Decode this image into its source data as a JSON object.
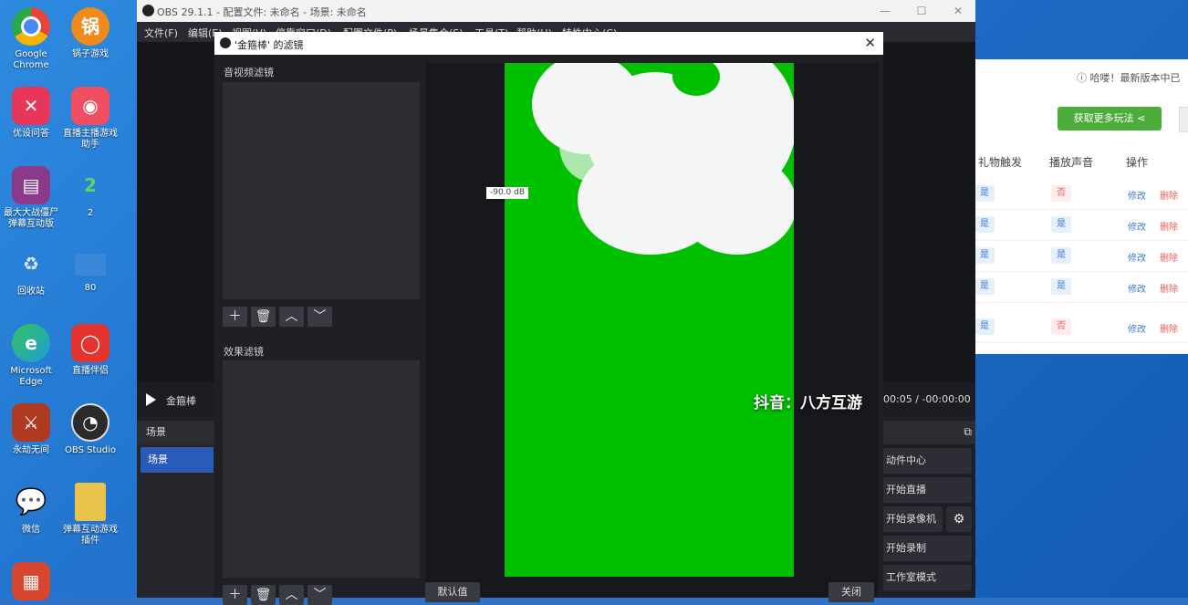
{
  "desktop": {
    "icons": [
      {
        "label": "Google Chrome",
        "icon": "chrome-icon",
        "color": "#e9443a"
      },
      {
        "label": "锅子游戏",
        "icon": "game-pot-icon",
        "color": "#f08a1c"
      },
      {
        "label": "优设问答",
        "icon": "video-edit-icon",
        "color": "#e8365b"
      },
      {
        "label": "直播主播游戏助手",
        "icon": "live-helper-icon",
        "color": "#f04e62"
      },
      {
        "label": "最大大战僵尸弹幕互动版",
        "icon": "winrar-icon",
        "color": "#8a3a88"
      },
      {
        "label": "2",
        "icon": "number-icon",
        "color": "#1e6bd0"
      },
      {
        "label": "回收站",
        "icon": "recycle-bin-icon",
        "color": "#4d8fd6"
      },
      {
        "label": "80",
        "icon": "blank-icon",
        "color": "#2a76d2"
      },
      {
        "label": "Microsoft Edge",
        "icon": "edge-icon",
        "color": "#1f9bd7"
      },
      {
        "label": "直播伴侣",
        "icon": "live-companion-icon",
        "color": "#e5332f"
      },
      {
        "label": "永劫无间",
        "icon": "naraka-icon",
        "color": "#b03a21"
      },
      {
        "label": "OBS Studio",
        "icon": "obs-icon",
        "color": "#2b2b2b"
      },
      {
        "label": "微信",
        "icon": "wechat-icon",
        "color": "#3ebf4a"
      },
      {
        "label": "弹幕互动游戏插件",
        "icon": "folder-icon",
        "color": "#e8c34a"
      },
      {
        "label": "",
        "icon": "app-icon",
        "color": "#d7462f"
      }
    ]
  },
  "webapp": {
    "notice": "哈喽！最新版本中已",
    "get_more": "获取更多玩法",
    "headers": [
      "礼物触发",
      "播放声音",
      "操作"
    ],
    "rows": [
      {
        "trigger": "是",
        "sound": "否",
        "edit": "修改",
        "delete": "删除"
      },
      {
        "trigger": "是",
        "sound": "是",
        "edit": "修改",
        "delete": "删除"
      },
      {
        "trigger": "是",
        "sound": "是",
        "edit": "修改",
        "delete": "删除"
      },
      {
        "trigger": "是",
        "sound": "是",
        "edit": "修改",
        "delete": "删除"
      },
      {
        "trigger": "是",
        "sound": "否",
        "edit": "修改",
        "delete": "删除"
      }
    ]
  },
  "obs": {
    "title": "OBS 29.1.1 - 配置文件: 未命名 - 场景: 未命名",
    "menu": [
      "文件(F)",
      "编辑(E)",
      "视图(V)",
      "停靠窗口(D)",
      "配置文件(P)",
      "场景集合(S)",
      "工具(T)",
      "帮助(H)",
      "特性中心(C)"
    ],
    "source_name": "金箍棒",
    "time": "00:05  /  -00:00:00",
    "scenes_header": "场景",
    "scene_item": "场景",
    "controls": [
      "动件中心",
      "开始直播",
      "开始录像机",
      "开始录制",
      "工作室模式"
    ]
  },
  "dialog": {
    "title": "'金箍棒' 的滤镜",
    "audio_video_filters": "音视频滤镜",
    "effect_filters": "效果滤镜",
    "db_label": "-90.0 dB",
    "default_button": "默认值",
    "close_button": "关闭",
    "chroma_color": "#00c000"
  },
  "watermark": "抖音：八方互游"
}
